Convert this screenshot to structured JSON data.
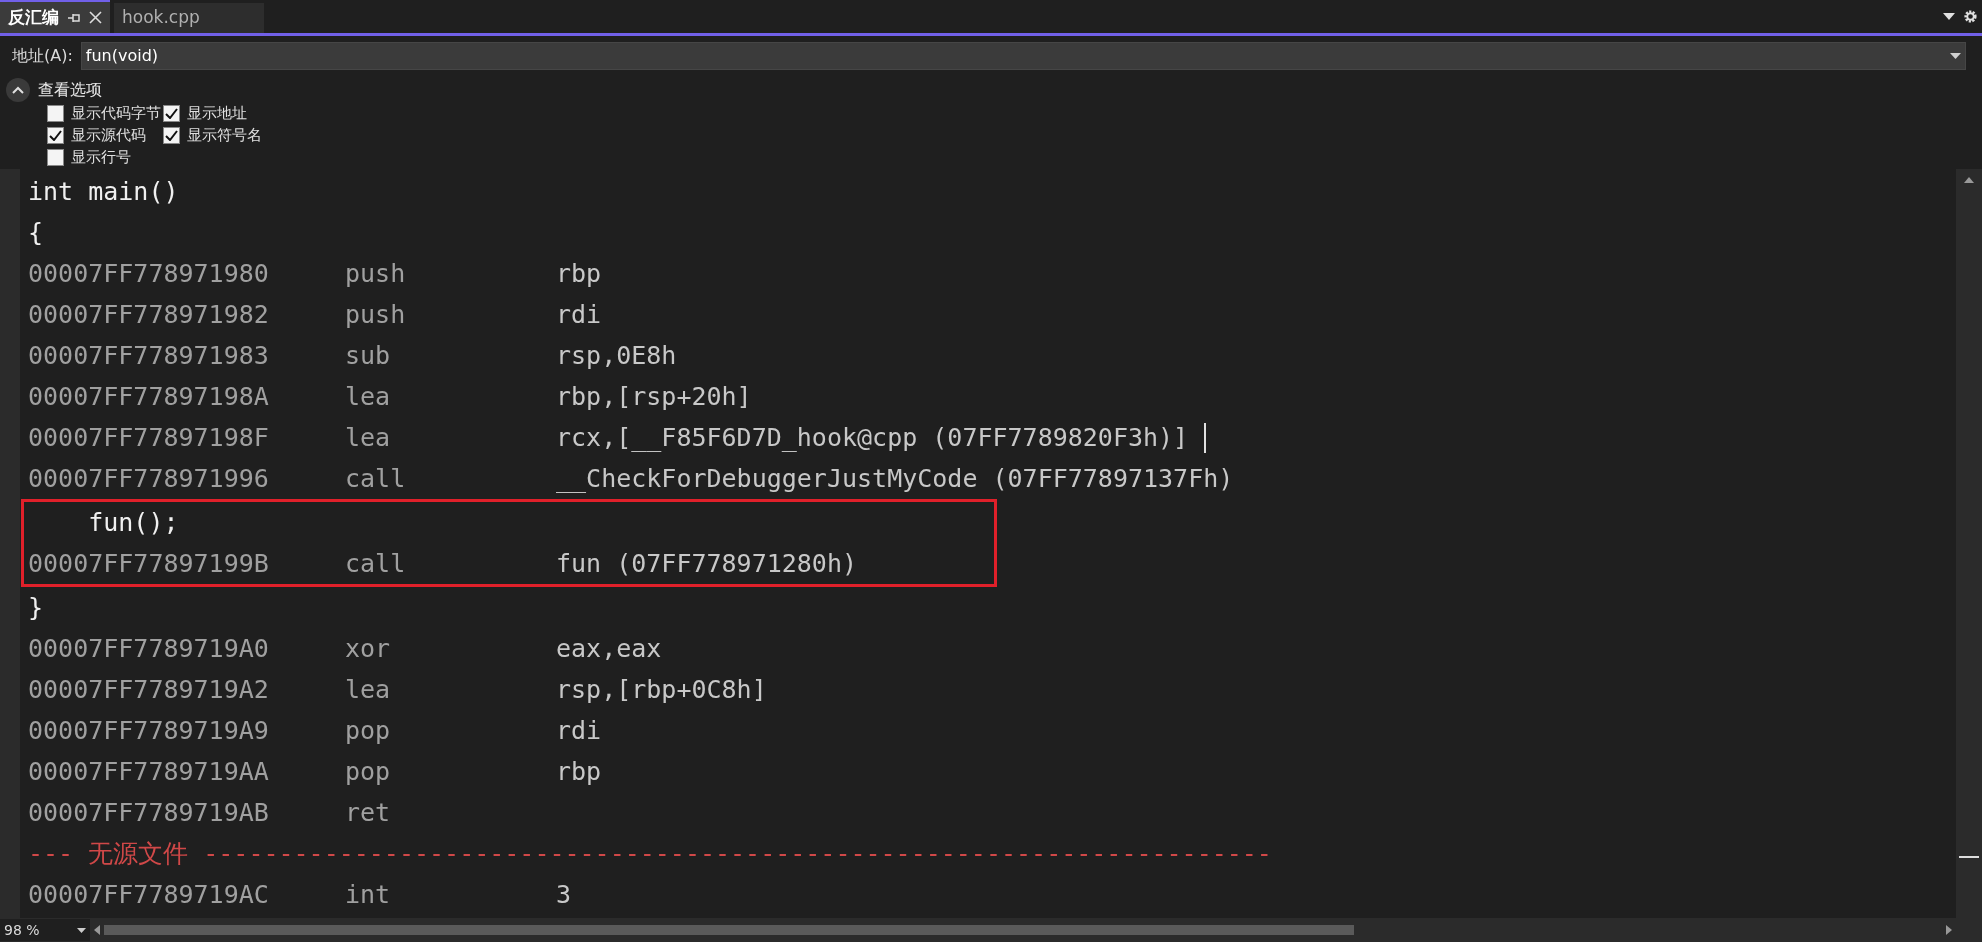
{
  "tabs": [
    {
      "label": "反汇编",
      "selected": true,
      "pinned": true
    },
    {
      "label": "hook.cpp",
      "selected": false,
      "pinned": false
    }
  ],
  "address": {
    "label": "地址(A):",
    "value": "fun(void)"
  },
  "view_options": {
    "title": "查看选项",
    "expanded": true,
    "options": [
      {
        "label": "显示代码字节",
        "checked": false
      },
      {
        "label": "显示地址",
        "checked": true
      },
      {
        "label": "显示源代码",
        "checked": true
      },
      {
        "label": "显示符号名",
        "checked": true
      },
      {
        "label": "显示行号",
        "checked": false
      }
    ]
  },
  "code": [
    {
      "kind": "source",
      "text": "int main()",
      "highlighted": false
    },
    {
      "kind": "source",
      "text": "{",
      "highlighted": false
    },
    {
      "kind": "instruction",
      "address": "00007FF778971980",
      "mnemonic": "push",
      "operands": "rbp",
      "highlighted": false
    },
    {
      "kind": "instruction",
      "address": "00007FF778971982",
      "mnemonic": "push",
      "operands": "rdi",
      "highlighted": false
    },
    {
      "kind": "instruction",
      "address": "00007FF778971983",
      "mnemonic": "sub",
      "operands": "rsp,0E8h",
      "highlighted": false
    },
    {
      "kind": "instruction",
      "address": "00007FF77897198A",
      "mnemonic": "lea",
      "operands": "rbp,[rsp+20h]",
      "highlighted": false
    },
    {
      "kind": "instruction",
      "address": "00007FF77897198F",
      "mnemonic": "lea",
      "operands": "rcx,[__F85F6D7D_hook@cpp (07FF7789820F3h)]",
      "highlighted": false,
      "cursor": true
    },
    {
      "kind": "instruction",
      "address": "00007FF778971996",
      "mnemonic": "call",
      "operands": "__CheckForDebuggerJustMyCode (07FF77897137Fh)",
      "highlighted": false
    },
    {
      "kind": "source",
      "text": "    fun();",
      "highlighted": true
    },
    {
      "kind": "instruction",
      "address": "00007FF77897199B",
      "mnemonic": "call",
      "operands": "fun (07FF778971280h)",
      "highlighted": true
    },
    {
      "kind": "source",
      "text": "}",
      "highlighted": false
    },
    {
      "kind": "instruction",
      "address": "00007FF7789719A0",
      "mnemonic": "xor",
      "operands": "eax,eax",
      "highlighted": false
    },
    {
      "kind": "instruction",
      "address": "00007FF7789719A2",
      "mnemonic": "lea",
      "operands": "rsp,[rbp+0C8h]",
      "highlighted": false
    },
    {
      "kind": "instruction",
      "address": "00007FF7789719A9",
      "mnemonic": "pop",
      "operands": "rdi",
      "highlighted": false
    },
    {
      "kind": "instruction",
      "address": "00007FF7789719AA",
      "mnemonic": "pop",
      "operands": "rbp",
      "highlighted": false
    },
    {
      "kind": "instruction",
      "address": "00007FF7789719AB",
      "mnemonic": "ret",
      "highlighted": false
    },
    {
      "kind": "separator",
      "text": "--- 无源文件 -----------------------------------------------------------------------",
      "highlighted": false
    },
    {
      "kind": "instruction",
      "address": "00007FF7789719AC",
      "mnemonic": "int",
      "operands": "3",
      "highlighted": false
    }
  ],
  "status_bar": {
    "zoom": "98 %"
  }
}
